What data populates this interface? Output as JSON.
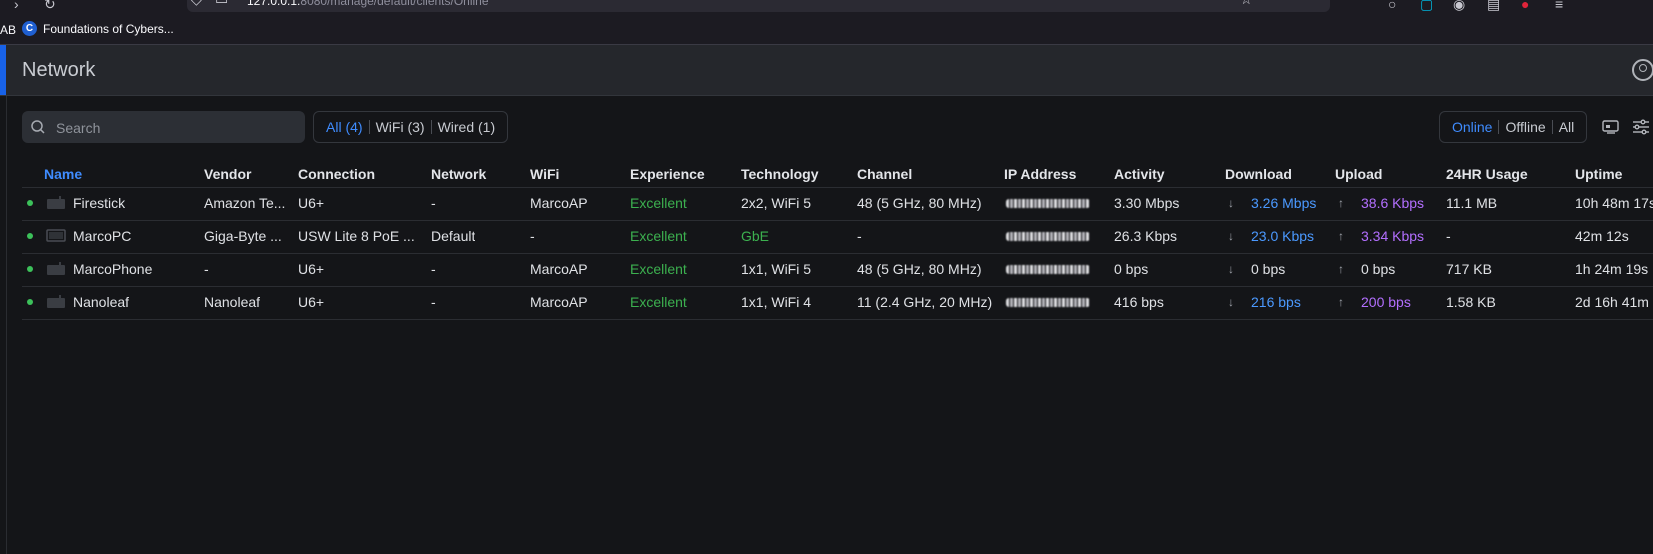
{
  "browser": {
    "url_prefix": "127.0.0.1:",
    "url_rest": "8080/manage/default/clients/Online",
    "bookmarks_partial": "AB",
    "bookmark_favicon": "C",
    "bookmark": "Foundations of Cybers..."
  },
  "app": {
    "title": "Network"
  },
  "toolbar": {
    "search_placeholder": "Search",
    "filters": [
      {
        "label": "All (4)",
        "active": true
      },
      {
        "label": "WiFi (3)",
        "active": false
      },
      {
        "label": "Wired (1)",
        "active": false
      }
    ],
    "status": [
      {
        "label": "Online",
        "active": true
      },
      {
        "label": "Offline",
        "active": false
      },
      {
        "label": "All",
        "active": false
      }
    ]
  },
  "table": {
    "columns": [
      "Name",
      "Vendor",
      "Connection",
      "Network",
      "WiFi",
      "Experience",
      "Technology",
      "Channel",
      "IP Address",
      "Activity",
      "Download",
      "Upload",
      "24HR Usage",
      "Uptime"
    ],
    "rows": [
      {
        "name": "Firestick",
        "vendor": "Amazon Te...",
        "connection": "U6+",
        "network": "-",
        "wifi": "MarcoAP",
        "experience": "Excellent",
        "technology": "2x2, WiFi 5",
        "channel": "48 (5 GHz, 80 MHz)",
        "activity": "3.30 Mbps",
        "download": "3.26 Mbps",
        "upload": "38.6 Kbps",
        "usage": "11.1 MB",
        "uptime": "10h 48m 17s"
      },
      {
        "name": "MarcoPC",
        "vendor": "Giga-Byte ...",
        "connection": "USW Lite 8 PoE ...",
        "network": "Default",
        "wifi": "-",
        "experience": "Excellent",
        "technology": "GbE",
        "channel": "-",
        "activity": "26.3 Kbps",
        "download": "23.0 Kbps",
        "upload": "3.34 Kbps",
        "usage": "-",
        "uptime": "42m 12s"
      },
      {
        "name": "MarcoPhone",
        "vendor": "-",
        "connection": "U6+",
        "network": "-",
        "wifi": "MarcoAP",
        "experience": "Excellent",
        "technology": "1x1, WiFi 5",
        "channel": "48 (5 GHz, 80 MHz)",
        "activity": "0 bps",
        "download": "0 bps",
        "upload": "0 bps",
        "usage": "717 KB",
        "uptime": "1h 24m 19s"
      },
      {
        "name": "Nanoleaf",
        "vendor": "Nanoleaf",
        "connection": "U6+",
        "network": "-",
        "wifi": "MarcoAP",
        "experience": "Excellent",
        "technology": "1x1, WiFi 4",
        "channel": "11 (2.4 GHz, 20 MHz)",
        "activity": "416 bps",
        "download": "216 bps",
        "upload": "200 bps",
        "usage": "1.58 KB",
        "uptime": "2d 16h 41m"
      }
    ],
    "arrows": {
      "down": "↓",
      "up": "↑"
    }
  },
  "colors": {
    "accent": "#1862e8",
    "active_blue": "#3f8cff",
    "excellent_green": "#3cb04f",
    "upload_purple": "#b36fff",
    "online_dot": "#3cc15a"
  }
}
